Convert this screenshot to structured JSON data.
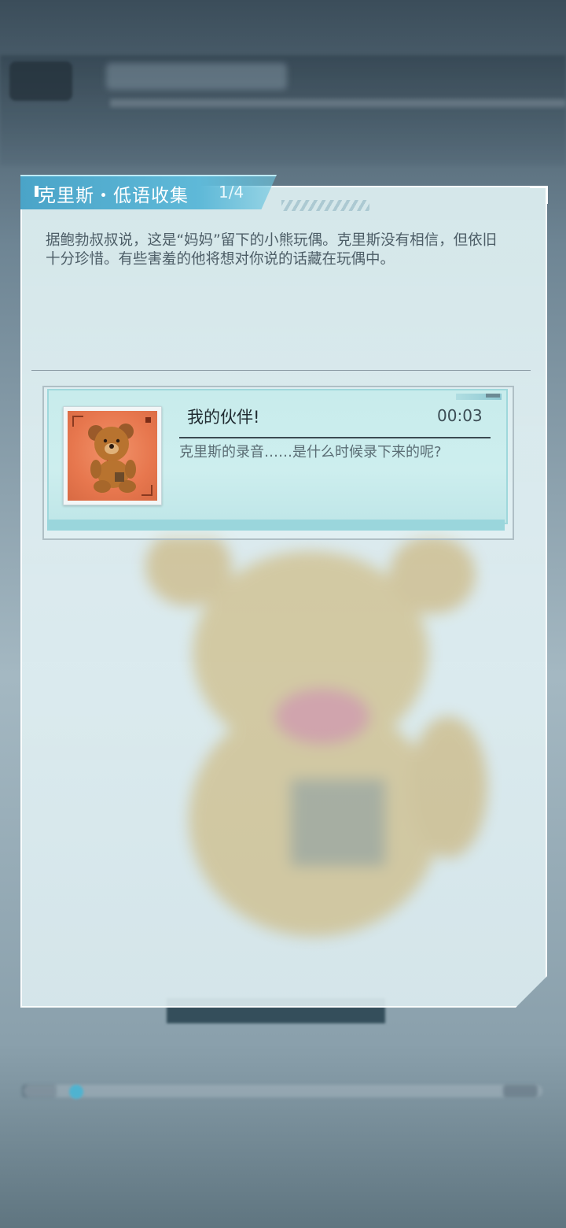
{
  "panel": {
    "title": "克里斯・低语收集",
    "count": "1/4",
    "description": "据鲍勃叔叔说，这是“妈妈”留下的小熊玩偶。克里斯没有相信，但依旧十分珍惜。有些害羞的他将想对你说的话藏在玩偶中。"
  },
  "recording": {
    "title": "我的伙伴!",
    "duration": "00:03",
    "description": "克里斯的录音……是什么时候录下来的呢?"
  },
  "icons": {
    "thumbnail": "teddy-bear-icon"
  },
  "colors": {
    "tab_accent": "#4aa4c8",
    "card_bg": "#c8ecec",
    "thumb_bg": "#e7774e"
  }
}
